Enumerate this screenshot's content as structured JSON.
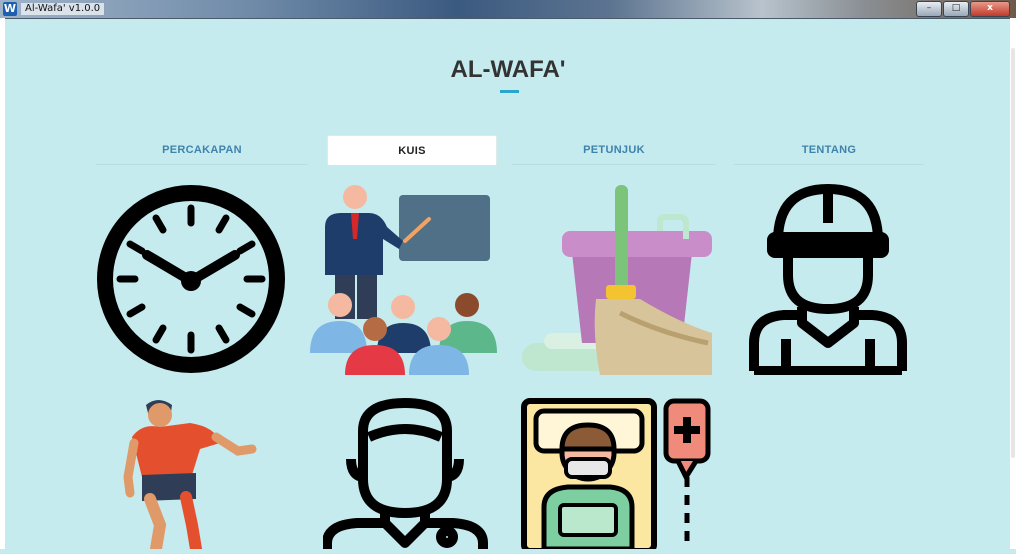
{
  "window": {
    "icon_letter": "W",
    "title": "Al-Wafa' v1.0.0",
    "minimize_label": "–",
    "maximize_label": "□",
    "close_label": "x"
  },
  "page": {
    "title": "AL-WAFA'",
    "accent_color": "#2ba6cb",
    "background_color": "#c5ebee"
  },
  "tabs": [
    {
      "label": "PERCAKAPAN",
      "active": false
    },
    {
      "label": "KUIS",
      "active": true
    },
    {
      "label": "PETUNJUK",
      "active": false
    },
    {
      "label": "TENTANG",
      "active": false
    }
  ],
  "tiles": [
    {
      "icon": "clock-icon"
    },
    {
      "icon": "teacher-classroom-icon"
    },
    {
      "icon": "cleaning-bucket-mop-icon"
    },
    {
      "icon": "construction-worker-icon"
    },
    {
      "icon": "soccer-player-icon"
    },
    {
      "icon": "doctor-icon"
    },
    {
      "icon": "hospital-patient-iv-icon"
    }
  ]
}
